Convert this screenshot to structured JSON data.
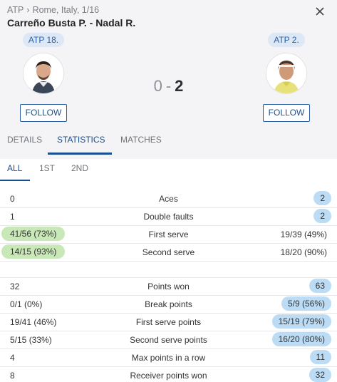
{
  "breadcrumb": {
    "sport": "ATP",
    "separator": "›",
    "location": "Rome, Italy, 1/16"
  },
  "match_title": "Carreño Busta P. - Nadal R.",
  "close_icon": "close-icon",
  "players": {
    "left": {
      "rank": "ATP 18.",
      "follow": "FOLLOW",
      "avatar": "player-avatar-carreno"
    },
    "right": {
      "rank": "ATP 2.",
      "follow": "FOLLOW",
      "avatar": "player-avatar-nadal"
    }
  },
  "score": {
    "left": "0",
    "dash": "-",
    "right": "2"
  },
  "tabs": [
    {
      "label": "DETAILS",
      "active": false
    },
    {
      "label": "STATISTICS",
      "active": true
    },
    {
      "label": "MATCHES",
      "active": false
    }
  ],
  "subtabs": [
    {
      "label": "ALL",
      "active": true
    },
    {
      "label": "1ST",
      "active": false
    },
    {
      "label": "2ND",
      "active": false
    }
  ],
  "stats_group_1": [
    {
      "left": "0",
      "label": "Aces",
      "right": "2",
      "highlight": "right"
    },
    {
      "left": "1",
      "label": "Double faults",
      "right": "2",
      "highlight": "right"
    },
    {
      "left": "41/56 (73%)",
      "label": "First serve",
      "right": "19/39 (49%)",
      "highlight": "left"
    },
    {
      "left": "14/15 (93%)",
      "label": "Second serve",
      "right": "18/20 (90%)",
      "highlight": "left"
    }
  ],
  "stats_group_2": [
    {
      "left": "32",
      "label": "Points won",
      "right": "63",
      "highlight": "right"
    },
    {
      "left": "0/1 (0%)",
      "label": "Break points",
      "right": "5/9 (56%)",
      "highlight": "right"
    },
    {
      "left": "19/41 (46%)",
      "label": "First serve points",
      "right": "15/19 (79%)",
      "highlight": "right"
    },
    {
      "left": "5/15 (33%)",
      "label": "Second serve points",
      "right": "16/20 (80%)",
      "highlight": "right"
    },
    {
      "left": "4",
      "label": "Max points in a row",
      "right": "11",
      "highlight": "right"
    },
    {
      "left": "8",
      "label": "Receiver points won",
      "right": "32",
      "highlight": "right"
    }
  ],
  "colors": {
    "accent": "#1a4f8f",
    "left_highlight": "#c9e8b8",
    "right_highlight": "#bcdcf5",
    "header_bg": "#f4f4f6"
  }
}
